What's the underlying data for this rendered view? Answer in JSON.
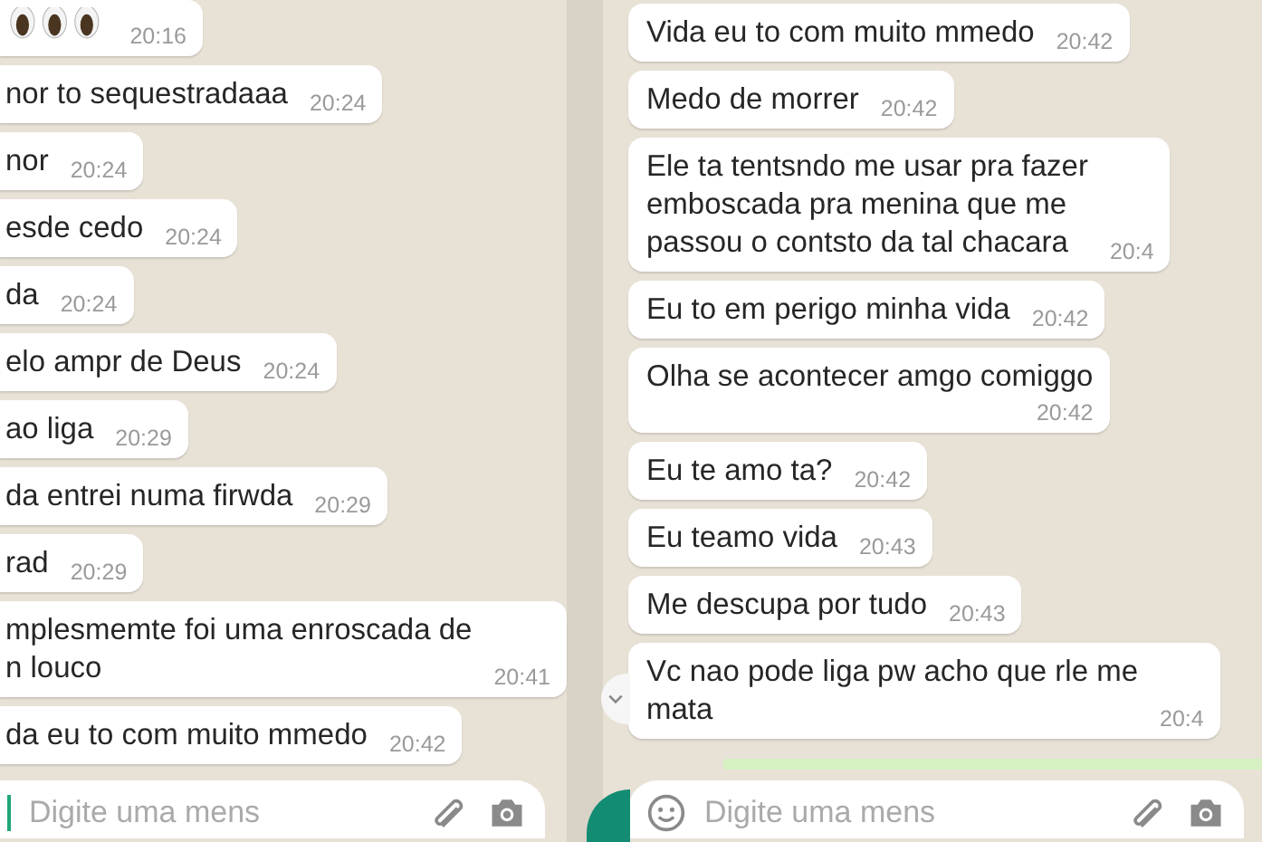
{
  "left_chat": {
    "messages": [
      {
        "kind": "emoji",
        "time": "20:16"
      },
      {
        "kind": "text",
        "text": "nor to sequestradaaa",
        "time": "20:24"
      },
      {
        "kind": "text",
        "text": "nor",
        "time": "20:24"
      },
      {
        "kind": "text",
        "text": "esde cedo",
        "time": "20:24"
      },
      {
        "kind": "text",
        "text": "da",
        "time": "20:24"
      },
      {
        "kind": "text",
        "text": "elo ampr de Deus",
        "time": "20:24"
      },
      {
        "kind": "text",
        "text": "ao liga",
        "time": "20:29"
      },
      {
        "kind": "text",
        "text": "da entrei numa firwda",
        "time": "20:29"
      },
      {
        "kind": "text",
        "text": "rad",
        "time": "20:29"
      },
      {
        "kind": "text",
        "text": "mplesmemte foi uma enroscada de\nn louco",
        "time": "20:41"
      },
      {
        "kind": "text",
        "text": "da eu to com muito mmedo",
        "time": "20:42"
      }
    ],
    "input": {
      "placeholder": "Digite uma mens",
      "emoji_button": false
    }
  },
  "right_chat": {
    "messages": [
      {
        "kind": "text",
        "text": "Vida eu to com muito mmedo",
        "time": "20:42"
      },
      {
        "kind": "text",
        "text": "Medo de morrer",
        "time": "20:42"
      },
      {
        "kind": "text",
        "text": "Ele ta tentsndo me usar pra fazer\nemboscada pra menina que me\npassou o contsto da tal chacara",
        "time": "20:4"
      },
      {
        "kind": "text",
        "text": "Eu to em perigo minha vida",
        "time": "20:42"
      },
      {
        "kind": "stacked",
        "text": "Olha se acontecer amgo comiggo",
        "time": "20:42"
      },
      {
        "kind": "text",
        "text": "Eu te amo ta?",
        "time": "20:42"
      },
      {
        "kind": "text",
        "text": "Eu teamo vida",
        "time": "20:43"
      },
      {
        "kind": "text",
        "text": "Me descupa por tudo",
        "time": "20:43"
      },
      {
        "kind": "text",
        "text": "Vc nao pode liga pw acho que rle me\nmata",
        "time": "20:4"
      }
    ],
    "input": {
      "placeholder": "Digite uma mens",
      "emoji_button": true
    }
  }
}
